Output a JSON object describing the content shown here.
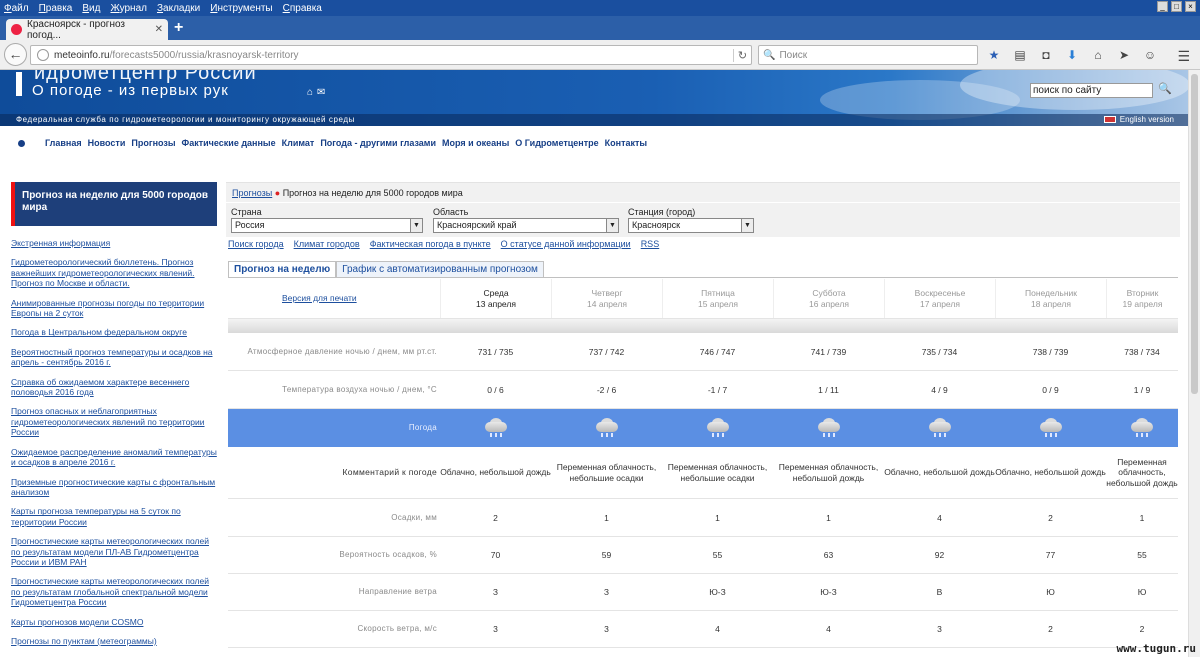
{
  "browser": {
    "menu": [
      {
        "label": "Файл",
        "u": "Ф",
        "rest": "айл"
      },
      {
        "label": "Правка",
        "u": "П",
        "rest": "равка"
      },
      {
        "label": "Вид",
        "u": "В",
        "rest": "ид"
      },
      {
        "label": "Журнал",
        "u": "Ж",
        "rest": "урнал"
      },
      {
        "label": "Закладки",
        "u": "З",
        "rest": "акладки"
      },
      {
        "label": "Инструменты",
        "u": "И",
        "rest": "нструменты"
      },
      {
        "label": "Справка",
        "u": "С",
        "rest": "правка"
      }
    ],
    "tab_title": "Красноярск - прогноз погод...",
    "url_host": "meteoinfo.ru",
    "url_path": "/forecasts5000/russia/krasnoyarsk-territory",
    "search_placeholder": "Поиск"
  },
  "site": {
    "slogan": "О погоде - из первых рук",
    "cut_title": "идрометцентр России",
    "search_value": "поиск по сайту",
    "federal_line": "Федеральная служба по гидрометеорологии и мониторингу окружающей среды",
    "english": "English version",
    "nav": [
      "Главная",
      "Новости",
      "Прогнозы",
      "Фактические данные",
      "Климат",
      "Погода - другими глазами",
      "Моря и океаны",
      "О Гидрометцентре",
      "Контакты"
    ]
  },
  "sidebar": {
    "title": "Прогноз на неделю для 5000 городов мира",
    "links": [
      "Экстренная информация",
      "Гидрометеорологический бюллетень. Прогноз важнейших гидрометеорологических явлений. Прогноз по Москве и области.",
      "Анимированные прогнозы погоды по территории Европы на 2 суток",
      "Погода в Центральном федеральном округе",
      "Вероятностный прогноз температуры и осадков на апрель - сентябрь 2016 г.",
      "Справка об ожидаемом характере весеннего половодья 2016 года",
      "Прогноз опасных и неблагоприятных гидрометеорологических явлений по территории России",
      "Ожидаемое распределение аномалий температуры и осадков в апреле 2016 г.",
      "Приземные прогностические карты с фронтальным анализом",
      "Карты прогноза температуры на 5 суток по территории России",
      "Прогностические карты метеорологических полей по результатам модели ПЛ-АВ Гидрометцентра России и ИВМ РАН",
      "Прогностические карты метеорологических полей по результатам глобальной спектральной модели Гидрометцентра России",
      "Карты прогнозов модели COSMO",
      "Прогнозы по пунктам (метеограммы)"
    ]
  },
  "main": {
    "crumb_link": "Прогнозы",
    "crumb_current": "Прогноз на неделю для 5000 городов мира",
    "filters": {
      "country_label": "Страна",
      "country_value": "Россия",
      "region_label": "Область",
      "region_value": "Красноярский край",
      "station_label": "Станция (город)",
      "station_value": "Красноярск"
    },
    "quick_links": [
      "Поиск города",
      "Климат городов",
      "Фактическая погода в пункте",
      "О статусе данной информации",
      "RSS"
    ],
    "tabs": [
      "Прогноз на неделю",
      "График с автоматизированным прогнозом"
    ],
    "print_link": "Версия для печати",
    "days": [
      {
        "name": "Среда",
        "date": "13 апреля"
      },
      {
        "name": "Четверг",
        "date": "14 апреля"
      },
      {
        "name": "Пятница",
        "date": "15 апреля"
      },
      {
        "name": "Суббота",
        "date": "16 апреля"
      },
      {
        "name": "Воскресенье",
        "date": "17 апреля"
      },
      {
        "name": "Понедельник",
        "date": "18 апреля"
      },
      {
        "name": "Вторник",
        "date": "19 апреля"
      }
    ],
    "row_labels": {
      "pressure": "Атмосферное давление ночью / днем, мм рт.ст.",
      "temp": "Температура воздуха ночью / днем, °С",
      "weather": "Погода",
      "comment": "Комментарий к погоде",
      "precip": "Осадки, мм",
      "prob": "Вероятность осадков, %",
      "wind_dir": "Направление ветра",
      "wind_speed": "Скорость ветра, м/с"
    },
    "pressure": [
      "731 / 735",
      "737 / 742",
      "746 / 747",
      "741 / 739",
      "735 / 734",
      "738 / 739",
      "738 / 734"
    ],
    "temp": [
      "0 / 6",
      "-2 / 6",
      "-1 / 7",
      "1 / 11",
      "4 / 9",
      "0 / 9",
      "1 / 9"
    ],
    "comment": [
      "Облачно, небольшой дождь",
      "Переменная облачность, небольшие осадки",
      "Переменная облачность, небольшие осадки",
      "Переменная облачность, небольшой дождь",
      "Облачно, небольшой дождь",
      "Облачно, небольшой дождь",
      "Переменная облачность, небольшой дождь"
    ],
    "precip": [
      "2",
      "1",
      "1",
      "1",
      "4",
      "2",
      "1"
    ],
    "prob": [
      "70",
      "59",
      "55",
      "63",
      "92",
      "77",
      "55"
    ],
    "wind_dir": [
      "З",
      "З",
      "Ю-З",
      "Ю-З",
      "В",
      "Ю",
      "Ю"
    ],
    "wind_speed": [
      "3",
      "3",
      "4",
      "4",
      "3",
      "2",
      "2"
    ]
  },
  "watermark": "www.tugun.ru"
}
